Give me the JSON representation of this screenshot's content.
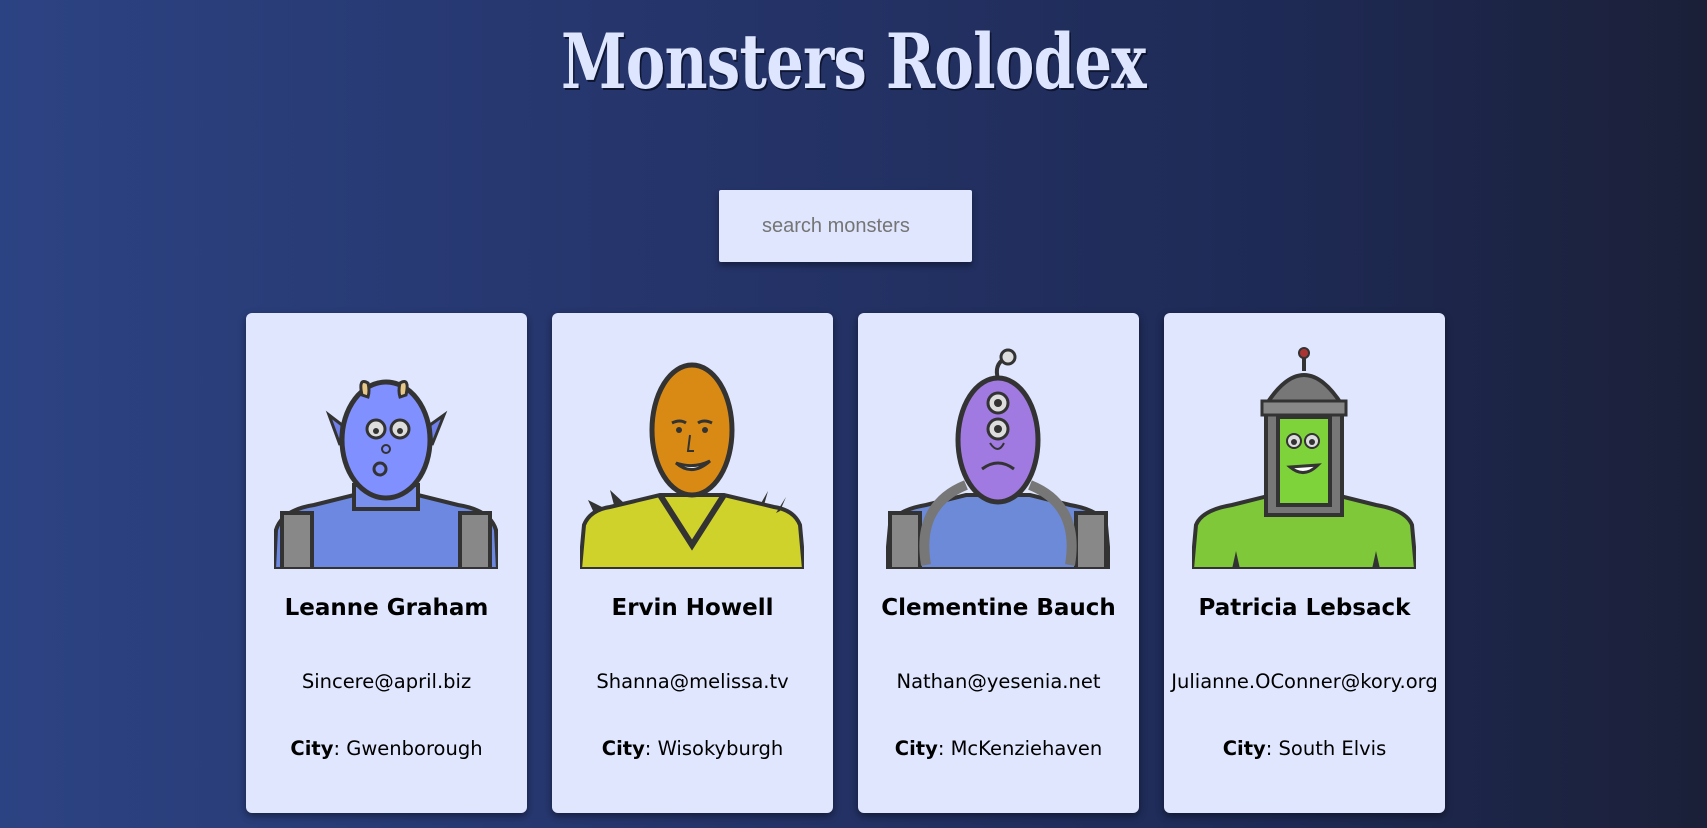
{
  "header": {
    "title": "Monsters Rolodex"
  },
  "search": {
    "placeholder": "search monsters",
    "value": ""
  },
  "city_label": "City",
  "monsters": [
    {
      "name": "Leanne Graham",
      "email": "Sincere@april.biz",
      "city": "Gwenborough",
      "skin_color": "#8090ff",
      "body_color": "#6c88e0"
    },
    {
      "name": "Ervin Howell",
      "email": "Shanna@melissa.tv",
      "city": "Wisokyburgh",
      "skin_color": "#d98a14",
      "body_color": "#cfd22a"
    },
    {
      "name": "Clementine Bauch",
      "email": "Nathan@yesenia.net",
      "city": "McKenziehaven",
      "skin_color": "#a07ae0",
      "body_color": "#6c8ad8"
    },
    {
      "name": "Patricia Lebsack",
      "email": "Julianne.OConner@kory.org",
      "city": "South Elvis",
      "skin_color": "#7ed33a",
      "body_color": "#7ec83a"
    }
  ]
}
